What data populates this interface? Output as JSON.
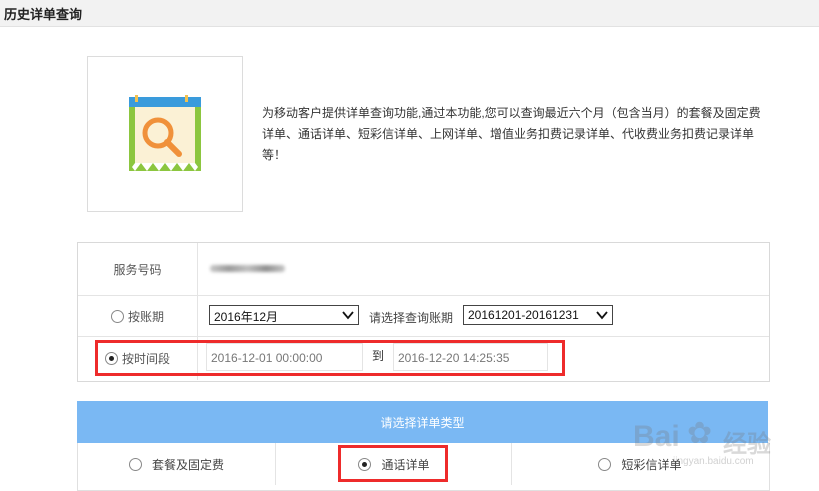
{
  "page": {
    "title": "历史详单查询"
  },
  "intro": {
    "text": "为移动客户提供详单查询功能,通过本功能,您可以查询最近六个月（包含当月）的套餐及固定费详单、通话详单、短彩信详单、上网详单、增值业务扣费记录详单、代收费业务扣费记录详单等！"
  },
  "form": {
    "service_label": "服务号码",
    "by_period": {
      "label": "按账期",
      "month": "2016年12月",
      "prompt": "请选择查询账期",
      "range": "20161201-20161231"
    },
    "by_time": {
      "label": "按时间段",
      "start": "2016-12-01 00:00:00",
      "to": "到",
      "end": "2016-12-20 14:25:35"
    }
  },
  "types": {
    "header": "请选择详单类型",
    "options": [
      "套餐及固定费",
      "通话详单",
      "短彩信详单"
    ],
    "selected": "通话详单"
  },
  "watermark": {
    "brand": "Bai",
    "brand2": "经验",
    "url": "jingyan.baidu.com"
  },
  "colors": {
    "accent": "#7ab8f3",
    "highlight": "#ee2b2b"
  }
}
